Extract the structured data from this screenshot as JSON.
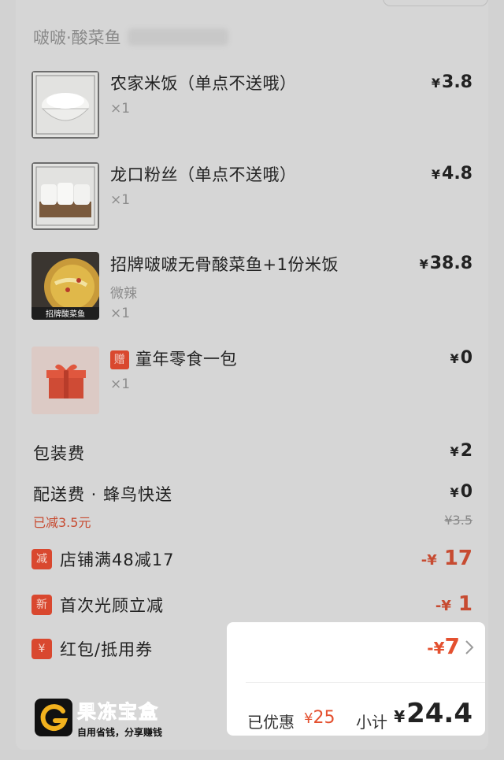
{
  "shop": {
    "name": "啵啵·酸菜鱼"
  },
  "items": [
    {
      "name": "农家米饭（单点不送哦）",
      "sub": "",
      "qty": "×1",
      "price": "3.8",
      "thumb": "rice-bowl"
    },
    {
      "name": "龙口粉丝（单点不送哦）",
      "sub": "",
      "qty": "×1",
      "price": "4.8",
      "thumb": "vermicelli"
    },
    {
      "name": "招牌啵啵无骨酸菜鱼+1份米饭",
      "sub": "微辣",
      "qty": "×1",
      "price": "38.8",
      "thumb": "fish-dish",
      "thumb_caption": "招牌酸菜鱼"
    },
    {
      "name": "童年零食一包",
      "tag": "赠",
      "sub": "",
      "qty": "×1",
      "price": "0",
      "thumb": "gift-box"
    }
  ],
  "currency": "¥",
  "fees": {
    "packaging_label": "包装费",
    "packaging_value": "2",
    "delivery_label": "配送费 · 蜂鸟快送",
    "delivery_value": "0",
    "delivery_note": "已减3.5元",
    "delivery_original": "¥3.5"
  },
  "discounts": [
    {
      "icon": "减",
      "label": "店铺满48减17",
      "value": "17"
    },
    {
      "icon": "新",
      "label": "首次光顾立减",
      "value": "1"
    },
    {
      "icon": "¥",
      "label": "红包/抵用券",
      "value": "7"
    }
  ],
  "summary": {
    "saved_label": "已优惠",
    "saved_value": "25",
    "subtotal_label": "小计",
    "subtotal_value": "24.4"
  },
  "watermark": {
    "title": "果冻宝盒",
    "slogan": "自用省钱，分享赚钱"
  },
  "colors": {
    "accent": "#e4502f",
    "dim_accent": "#c74b31",
    "tag": "#d9482f"
  }
}
